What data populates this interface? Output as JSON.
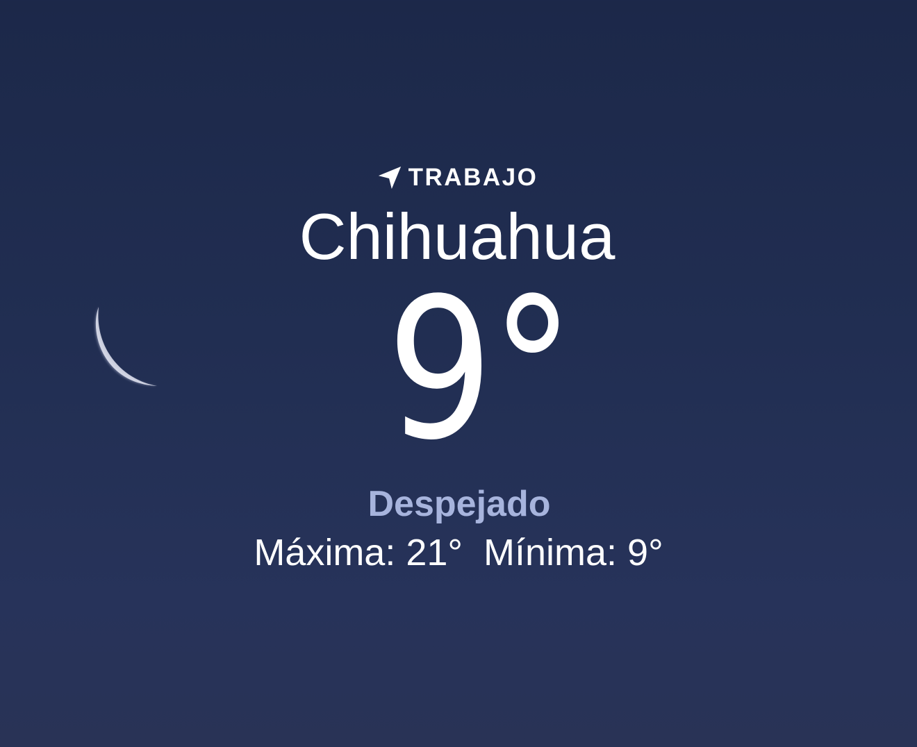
{
  "location": {
    "icon": "location-arrow-icon",
    "label": "TRABAJO"
  },
  "city": "Chihuahua",
  "temperature": "9°",
  "condition": "Despejado",
  "high": "Máxima: 21°",
  "low": "Mínima: 9°",
  "background": {
    "icon": "crescent-moon-icon",
    "top_color": "#1c2849",
    "bottom_color": "#293356"
  },
  "colors": {
    "condition_text": "#a7b4dd",
    "primary_text": "#ffffff"
  }
}
